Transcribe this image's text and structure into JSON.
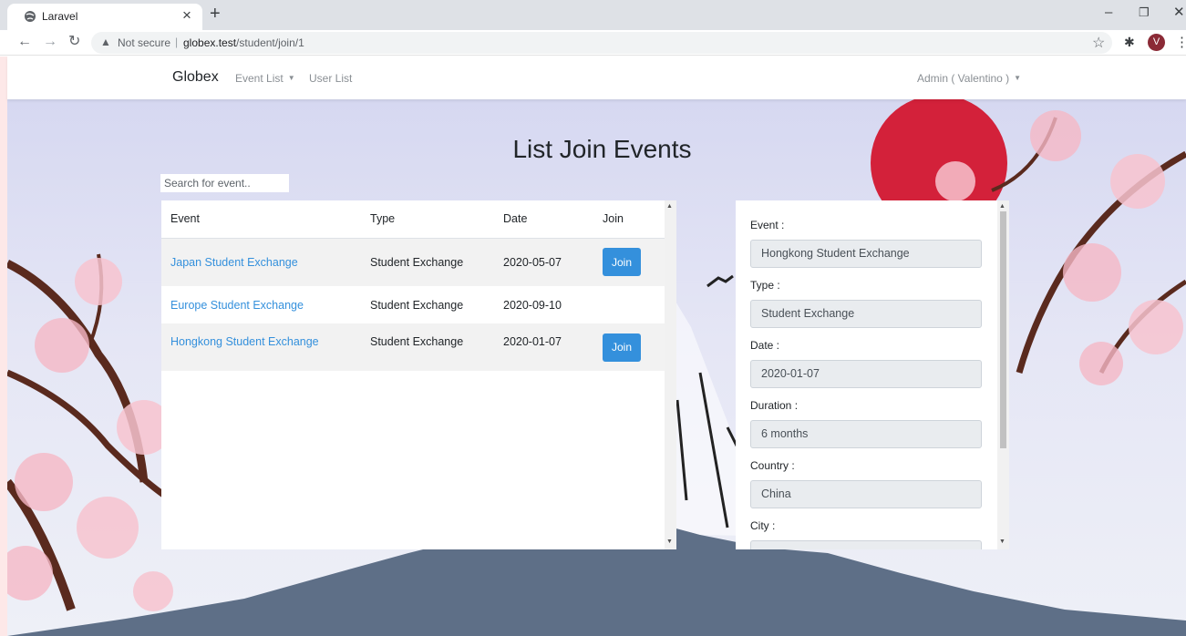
{
  "browser": {
    "tab_title": "Laravel",
    "url_security": "Not secure",
    "url_host": "globex.test",
    "url_path": "/student/join/1",
    "profile_initial": "V"
  },
  "navbar": {
    "brand": "Globex",
    "event_list": "Event List",
    "user_list": "User List",
    "user_menu": "Admin ( Valentino )"
  },
  "page": {
    "title": "List Join Events",
    "search_placeholder": "Search for event.."
  },
  "table": {
    "headers": [
      "Event",
      "Type",
      "Date",
      "Join"
    ],
    "rows": [
      {
        "event": "Japan Student Exchange",
        "type": "Student Exchange",
        "date": "2020-05-07",
        "join": "Join"
      },
      {
        "event": "Europe Student Exchange",
        "type": "Student Exchange",
        "date": "2020-09-10"
      },
      {
        "event": "Hongkong Student Exchange",
        "type": "Student Exchange",
        "date": "2020-01-07",
        "join": "Join"
      }
    ]
  },
  "details": {
    "event_label": "Event :",
    "event_value": "Hongkong Student Exchange",
    "type_label": "Type :",
    "type_value": "Student Exchange",
    "date_label": "Date :",
    "date_value": "2020-01-07",
    "duration_label": "Duration :",
    "duration_value": "6 months",
    "country_label": "Country :",
    "country_value": "China",
    "city_label": "City :"
  },
  "colors": {
    "accent": "#3490dc",
    "sun": "#d3213a",
    "mountain": "#5e6f87"
  }
}
